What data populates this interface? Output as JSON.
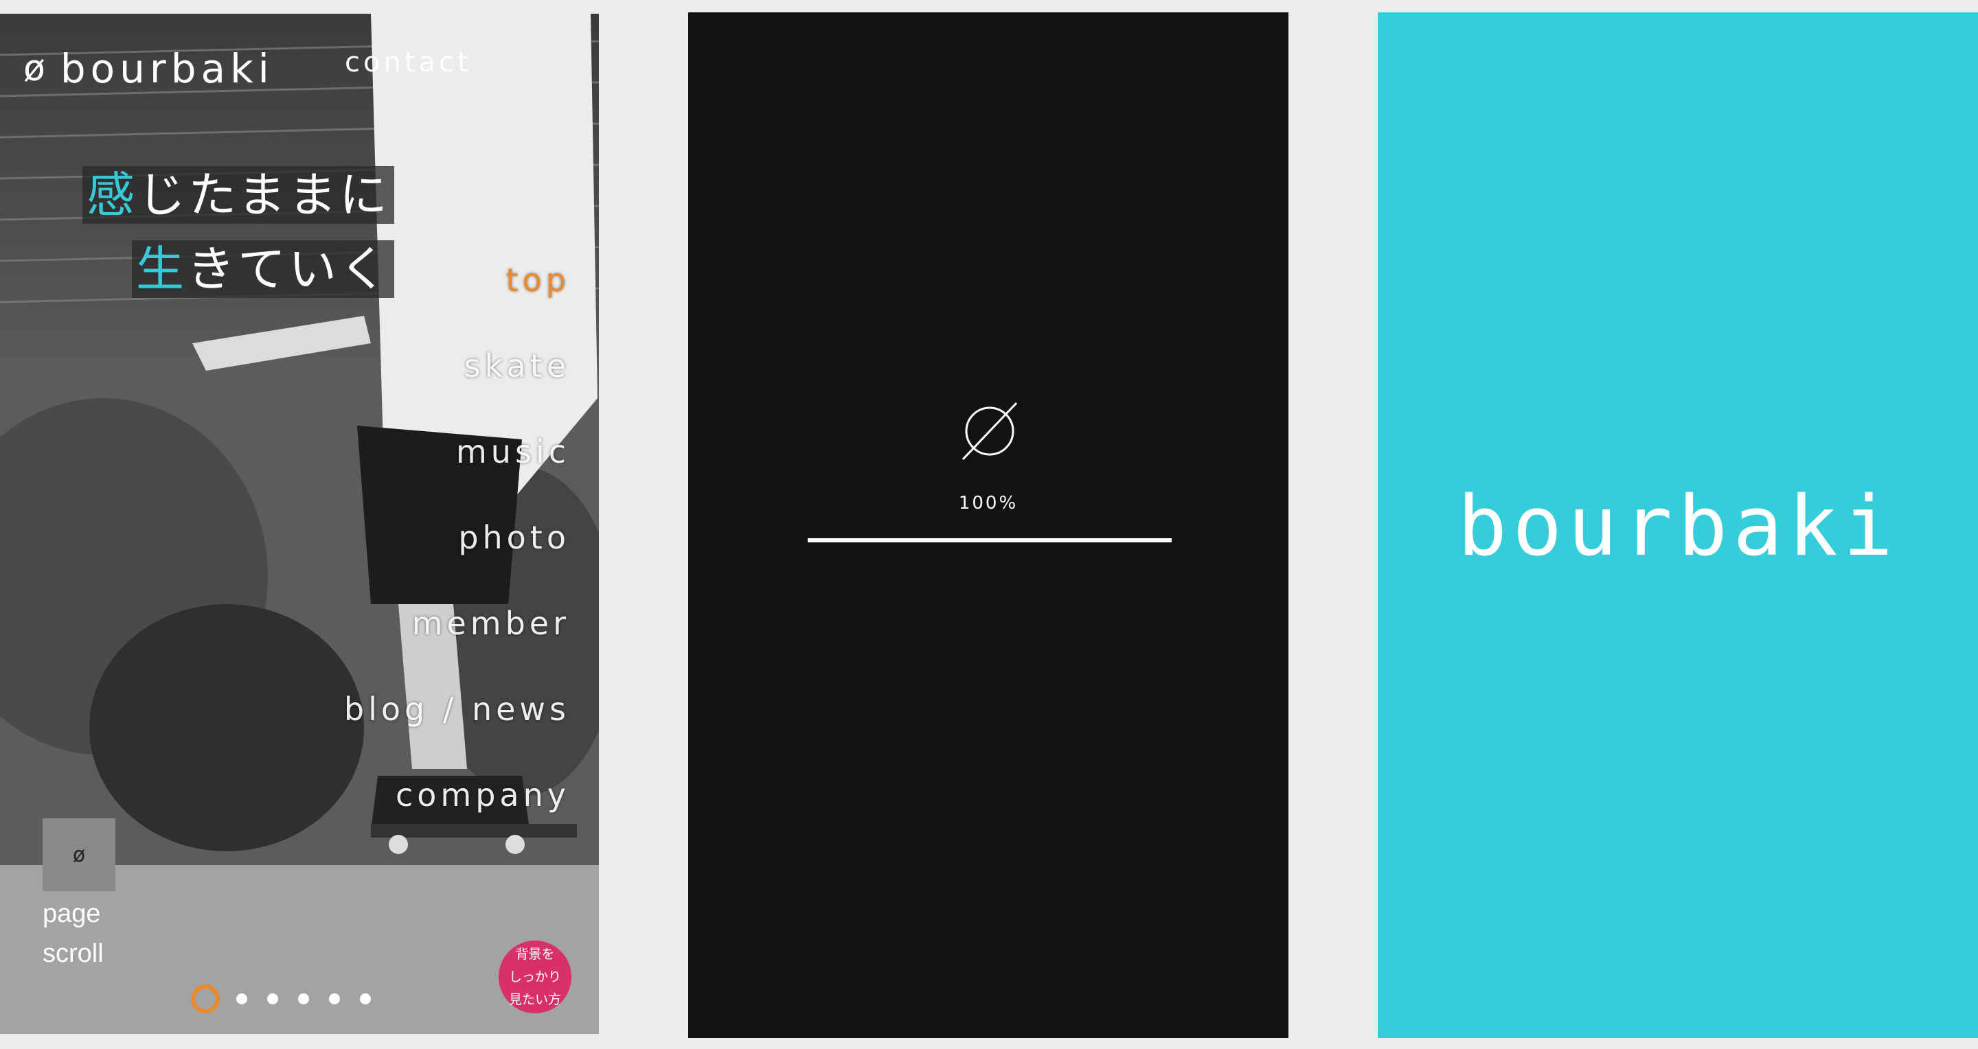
{
  "panel1": {
    "logo_mark": "ø",
    "logo_text": "bourbaki",
    "contact": "contact",
    "catch_line1_accent": "感",
    "catch_line1_rest": "じたままに",
    "catch_line2_accent": "生",
    "catch_line2_rest": "きていく",
    "nav": [
      "top",
      "skate",
      "music",
      "photo",
      "member",
      "blog / news",
      "company"
    ],
    "active_nav": "top",
    "scroll_box_label": "ø",
    "scroll_text_line1": "page",
    "scroll_text_line2": "scroll",
    "slider_dots_count": 7,
    "slider_active_index": 0,
    "bg_button_line1": "背景を",
    "bg_button_line2": "しっかり",
    "bg_button_line3": "見たい方"
  },
  "panel2": {
    "loader_symbol": "empty-set-icon",
    "progress_text": "100%",
    "progress": 1.0
  },
  "panel3": {
    "logo": "bourbaki"
  },
  "colors": {
    "accent_cyan": "#38c9d8",
    "accent_orange": "#ea8a2c",
    "button_pink": "#d8306a",
    "loader_bg": "#121212",
    "brand_bg": "#36cddb"
  }
}
